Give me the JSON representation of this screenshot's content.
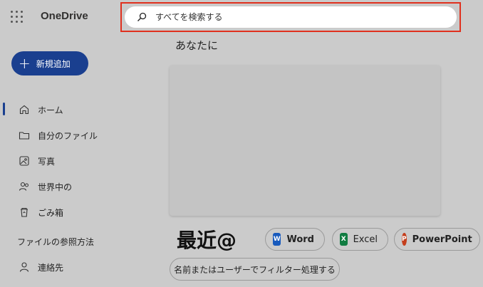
{
  "app": {
    "brand": "OneDrive"
  },
  "search": {
    "placeholder": "すべてを検索する"
  },
  "new_button": {
    "label": "新規追加"
  },
  "nav": {
    "items": [
      {
        "label": "ホーム",
        "icon": "home-icon",
        "active": true
      },
      {
        "label": "自分のファイル",
        "icon": "folder-icon"
      },
      {
        "label": "写真",
        "icon": "photo-icon"
      },
      {
        "label": "世界中の",
        "icon": "people-icon"
      },
      {
        "label": "ごみ箱",
        "icon": "recycle-bin-icon"
      }
    ],
    "section_title": "ファイルの参照方法",
    "contacts": {
      "label": "連絡先",
      "icon": "person-icon"
    }
  },
  "main": {
    "for_you_title": "あなたに",
    "recent_title": "最近@",
    "filters": {
      "word": "Word",
      "excel": "Excel",
      "powerpoint": "PowerPoint",
      "filter_by_name": "名前またはユーザーでフィルター処理する"
    }
  },
  "colors": {
    "accent": "#1a3f8f",
    "highlight_border": "#e0301e",
    "word": "#185abd",
    "excel": "#107c41",
    "powerpoint": "#c43e1c"
  }
}
